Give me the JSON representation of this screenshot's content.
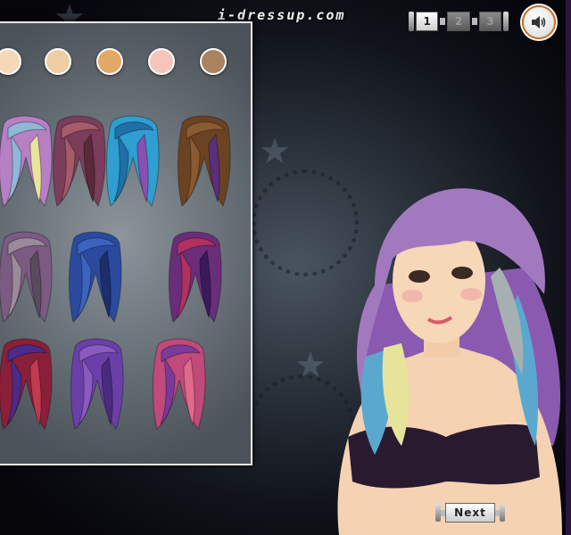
{
  "site": {
    "logo_text": "i-dressup.com"
  },
  "pager": {
    "pages": [
      "1",
      "2",
      "3"
    ],
    "active_page": "1"
  },
  "sound": {
    "icon": "speaker-icon"
  },
  "skin_tones": [
    "#f6d8b8",
    "#f0cca2",
    "#e3a866",
    "#f5c5bc",
    "#a9825e"
  ],
  "hair_options": [
    {
      "name": "pastel-pigtail",
      "colors": [
        "#b77fc4",
        "#8fb8d8",
        "#e8e4a0"
      ]
    },
    {
      "name": "short-brown-purple",
      "colors": [
        "#7a3e5a",
        "#a65a6a",
        "#5a2a3a"
      ]
    },
    {
      "name": "blue-bob-bangs",
      "colors": [
        "#2f9ed0",
        "#1f6fa8",
        "#8a4fb0"
      ]
    },
    {
      "name": "brown-purple-shoulder",
      "colors": [
        "#6b4322",
        "#8a5a30",
        "#5a2e7a"
      ]
    },
    {
      "name": "purple-updo",
      "colors": [
        "#7b5b82",
        "#9a8a9a",
        "#5a4a5e"
      ]
    },
    {
      "name": "blue-twin-braids",
      "colors": [
        "#2b4a9e",
        "#3c63c0",
        "#1c2f6a"
      ]
    },
    {
      "name": "purple-red-streaks",
      "colors": [
        "#6a2d7a",
        "#b03060",
        "#3a1a5a"
      ]
    },
    {
      "name": "red-purple-streaks",
      "colors": [
        "#8a1f3a",
        "#4a2a8a",
        "#c03a50"
      ]
    },
    {
      "name": "violet-long-wave",
      "colors": [
        "#6b3fa8",
        "#8a5ac0",
        "#4a2a80"
      ]
    },
    {
      "name": "pink-purple-curls",
      "colors": [
        "#c04a7a",
        "#7a3a9a",
        "#e06a8a"
      ]
    }
  ],
  "model": {
    "hair": [
      "#9a6ab6",
      "#5aa8d0",
      "#e6e49a",
      "#a7b0b0"
    ],
    "top": "#2a1a30"
  },
  "next_button": {
    "label": "Next"
  }
}
